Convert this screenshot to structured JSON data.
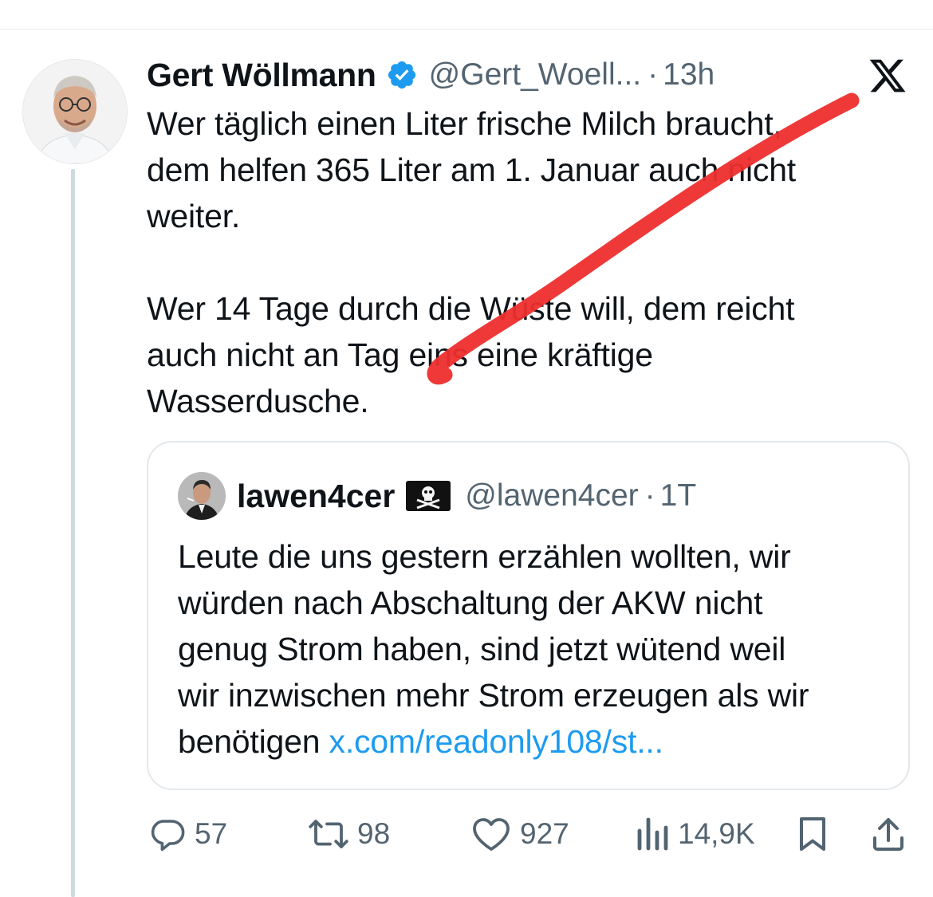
{
  "tweet": {
    "author": {
      "display_name": "Gert Wöllmann",
      "verified": true,
      "handle": "@Gert_Woell...",
      "separator": "·",
      "time": "13h"
    },
    "text": "Wer täglich einen Liter frische Milch braucht,\ndem helfen 365 Liter am 1. Januar auch nicht\nweiter.\n\nWer 14 Tage durch die Wüste will, dem reicht\nauch nicht an Tag eins eine kräftige\nWasserdusche.",
    "quote": {
      "display_name": "lawen4cer",
      "handle": "@lawen4cer",
      "separator": "·",
      "time": "1T",
      "text": "Leute die uns gestern erzählen wollten, wir\nwürden nach Abschaltung der AKW nicht\ngenug Strom haben, sind jetzt wütend weil\nwir inzwischen mehr Strom erzeugen als wir\nbenötigen ",
      "link": "x.com/readonly108/st..."
    },
    "actions": {
      "replies": "57",
      "reposts": "98",
      "likes": "927",
      "views": "14,9K"
    }
  },
  "icons": {
    "verified": "verified-badge-icon",
    "brand": "x-logo-icon",
    "flag": "pirate-flag-emoji",
    "reply": "reply-icon",
    "repost": "repost-icon",
    "like": "heart-icon",
    "views": "views-icon",
    "bookmark": "bookmark-icon",
    "share": "share-icon"
  },
  "colors": {
    "text": "#0f1419",
    "secondary": "#536471",
    "link": "#1d9bf0",
    "verified": "#1d9bf0",
    "annotation_stroke": "#ee2e2e"
  }
}
